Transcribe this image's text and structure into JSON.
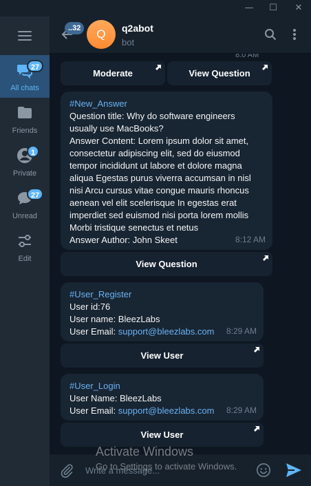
{
  "window": {
    "minimize_glyph": "—",
    "maximize_glyph": "☐",
    "close_glyph": "✕"
  },
  "sidebar": {
    "folders": [
      {
        "label": "All chats",
        "badge": "27",
        "icon": "chats-icon",
        "active": true
      },
      {
        "label": "Friends",
        "badge": "",
        "icon": "folder-icon"
      },
      {
        "label": "Private",
        "badge": "1",
        "icon": "user-icon"
      },
      {
        "label": "Unread",
        "badge": "27",
        "icon": "chat-bubble-icon"
      },
      {
        "label": "Edit",
        "badge": "",
        "icon": "sliders-icon"
      }
    ]
  },
  "header": {
    "back_badge": "..32",
    "avatar_letter": "Q",
    "name": "q2abot",
    "status": "bot"
  },
  "messages": {
    "partial_time": "8:0 AM",
    "kb1": {
      "moderate": "Moderate",
      "view_question": "View Question"
    },
    "msg1": {
      "tag": "#New_Answer",
      "question_title": "Question title: Why do software engineers usually use MacBooks?",
      "answer_content": "Answer Content: Lorem ipsum dolor sit amet, consectetur adipiscing elit, sed do eiusmod tempor incididunt ut labore et dolore magna aliqua Egestas purus viverra accumsan in nisl nisi Arcu cursus vitae congue mauris rhoncus aenean vel elit scelerisque In egestas erat imperdiet sed euismod nisi porta lorem mollis Morbi tristique senectus et netus",
      "author": "Answer Author: John Skeet",
      "time": "8:12 AM",
      "button": "View Question"
    },
    "msg2": {
      "tag": "#User_Register",
      "user_id": "User id:76",
      "user_name": "User name: BleezLabs",
      "email_label": "User Email: ",
      "email": "support@bleezlabs.com",
      "time": "8:29 AM",
      "button": "View User"
    },
    "msg3": {
      "tag": "#User_Login",
      "user_name": "User Name: BleezLabs",
      "email_label": "User Email: ",
      "email": "support@bleezlabs.com",
      "time": "8:29 AM",
      "button": "View User"
    }
  },
  "composer": {
    "placeholder": "Write a message..."
  },
  "watermark": {
    "title": "Activate Windows",
    "subtitle": "Go to Settings to activate Windows."
  },
  "colors": {
    "accent": "#5eb5f7",
    "link": "#6ab2f2",
    "bubble": "#182533",
    "background": "#0e1621"
  }
}
